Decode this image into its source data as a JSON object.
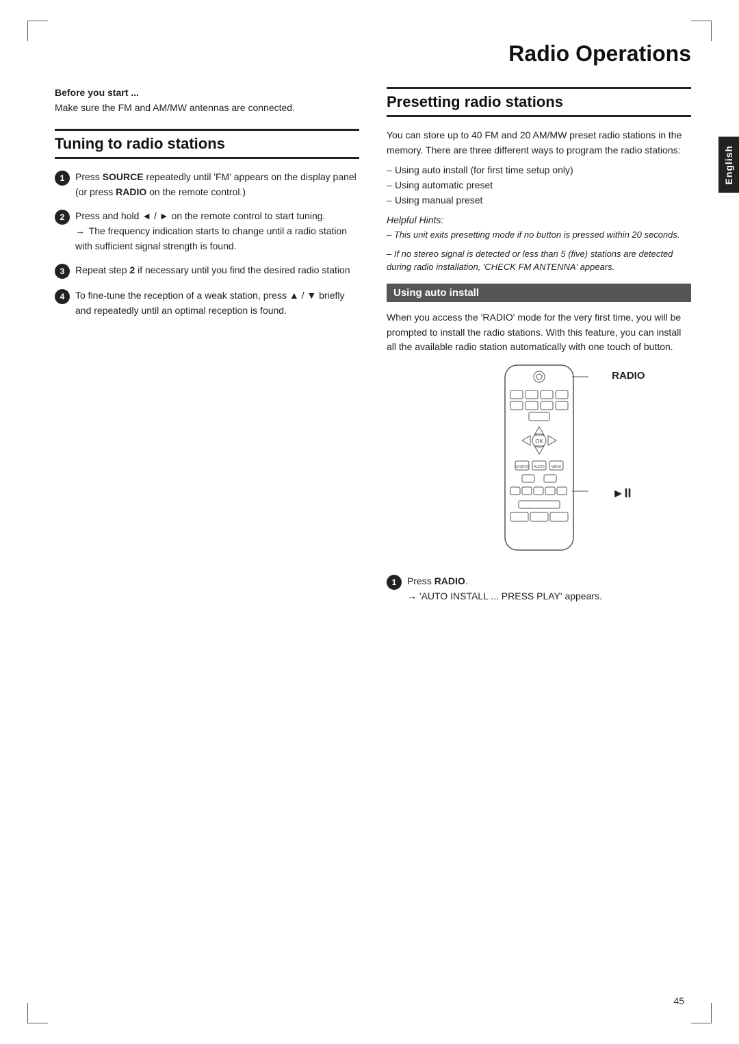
{
  "page": {
    "title": "Radio Operations",
    "page_number": "45",
    "language_tab": "English"
  },
  "left_column": {
    "before_start": {
      "title": "Before you start ...",
      "text": "Make sure the FM and AM/MW antennas are connected."
    },
    "tuning_section": {
      "header": "Tuning to radio stations",
      "steps": [
        {
          "number": "1",
          "text": "Press SOURCE repeatedly until 'FM' appears on the display panel (or press RADIO on the remote control.)"
        },
        {
          "number": "2",
          "text": "Press and hold ◄ / ► on the remote control to start tuning.\n→ The frequency indication starts to change until a radio station with sufficient signal strength is found."
        },
        {
          "number": "3",
          "text": "Repeat step 2 if necessary until you find the desired radio station"
        },
        {
          "number": "4",
          "text": "To fine-tune the reception of a weak station, press ▲ / ▼ briefly and repeatedly until an optimal reception is found."
        }
      ]
    }
  },
  "right_column": {
    "presetting_section": {
      "header": "Presetting radio stations",
      "intro": "You can store up to 40 FM and 20 AM/MW preset radio stations in the memory. There are three different ways to program the radio stations:",
      "methods": [
        "Using auto install (for first time setup only)",
        "Using automatic preset",
        "Using manual preset"
      ],
      "helpful_hints": {
        "title": "Helpful Hints:",
        "hints": [
          "– This unit exits presetting mode if no button is pressed within 20 seconds.",
          "– If no stereo signal is detected or less than 5 (five) stations are detected during radio installation, 'CHECK FM ANTENNA' appears."
        ]
      }
    },
    "auto_install": {
      "header": "Using auto install",
      "text": "When you access the 'RADIO' mode for the very first time, you will be prompted to install the radio stations.  With this feature, you can install all the available radio station automatically with one touch of button.",
      "remote_labels": {
        "radio": "RADIO",
        "play_pause": "►II"
      },
      "steps": [
        {
          "number": "1",
          "text": "Press RADIO.",
          "sub": "→ 'AUTO INSTALL ... PRESS PLAY' appears."
        }
      ]
    }
  }
}
